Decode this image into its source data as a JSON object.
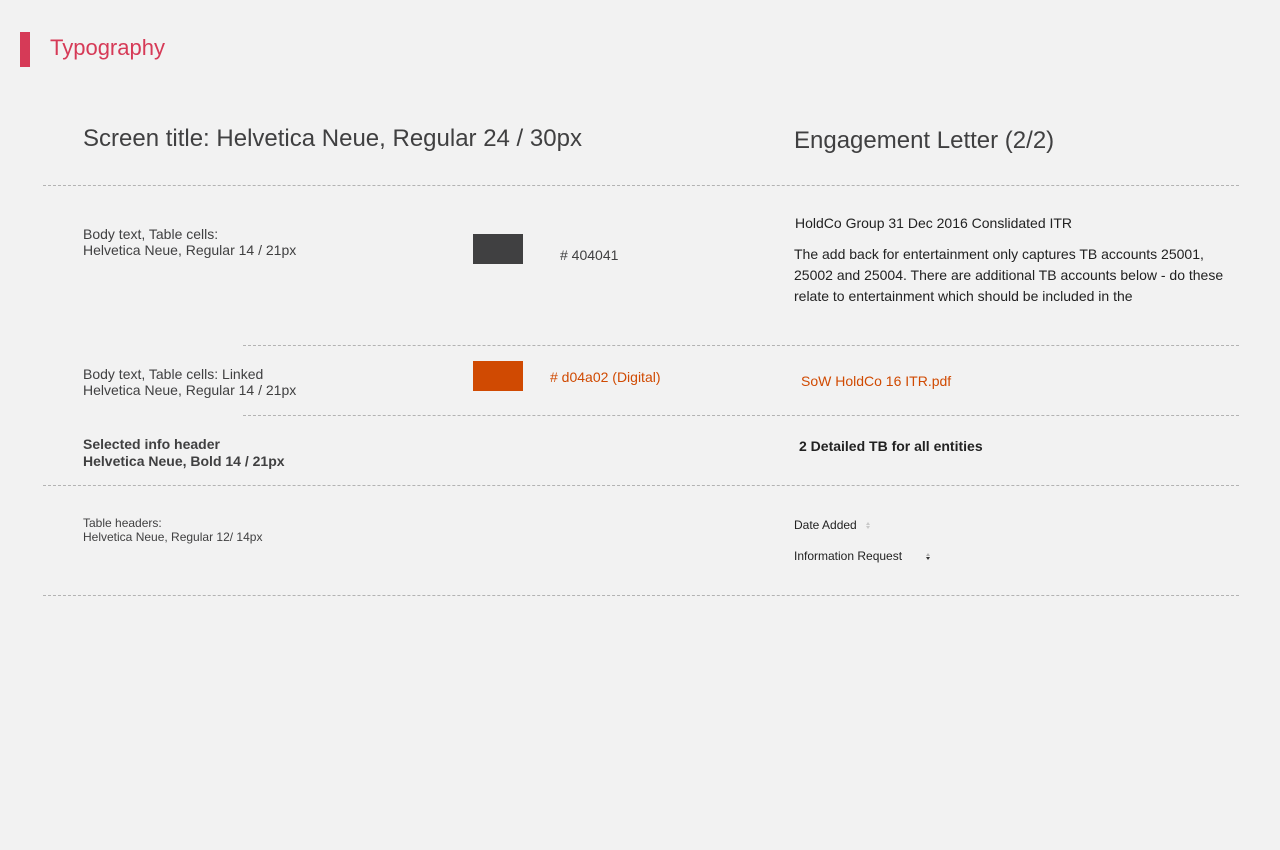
{
  "section": {
    "title": "Typography",
    "accent_color": "#d63a57"
  },
  "screen_title": {
    "spec": "Screen title: Helvetica Neue, Regular 24 / 30px",
    "example": "Engagement Letter (2/2)"
  },
  "body_text": {
    "spec_line1": "Body text, Table cells:",
    "spec_line2": "Helvetica Neue, Regular 14 / 21px",
    "color_hex": "#404041",
    "color_label": "# 404041",
    "example_title": "HoldCo Group 31 Dec 2016 Conslidated ITR",
    "example_paragraph": "The add back for entertainment only captures TB accounts 25001, 25002 and 25004. There are additional TB accounts below - do these relate to  entertainment which should be included in the"
  },
  "linked_text": {
    "spec_line1": "Body text, Table cells: Linked",
    "spec_line2": "Helvetica Neue, Regular 14 / 21px",
    "color_hex": "#d04a02",
    "color_label": "# d04a02 (Digital)",
    "example": "SoW HoldCo 16 ITR.pdf"
  },
  "selected_header": {
    "spec_line1": "Selected info header",
    "spec_line2": "Helvetica Neue, Bold 14 / 21px",
    "example": "2 Detailed TB for all entities"
  },
  "table_headers": {
    "spec_line1": "Table headers:",
    "spec_line2": "Helvetica Neue, Regular 12/ 14px",
    "items": [
      {
        "label": "Date Added",
        "icon": "sort-icon"
      },
      {
        "label": "Information Request",
        "icon": "sort-descending-icon"
      }
    ]
  }
}
